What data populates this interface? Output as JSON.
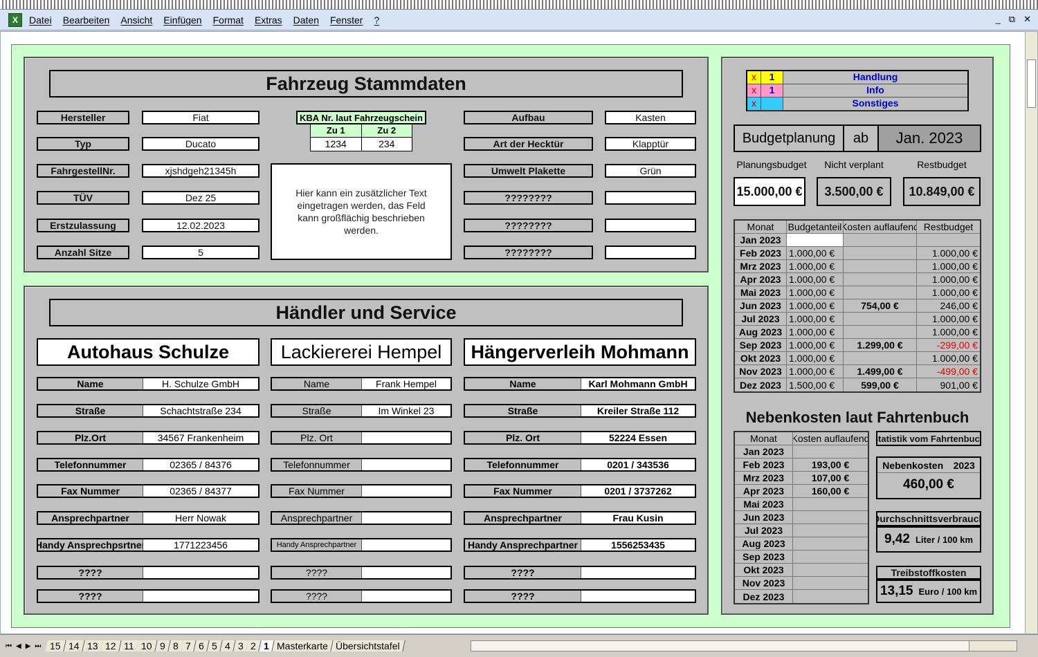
{
  "menu": [
    "Datei",
    "Bearbeiten",
    "Ansicht",
    "Einfügen",
    "Format",
    "Extras",
    "Daten",
    "Fenster",
    "?"
  ],
  "app_icon": "excel-icon",
  "window_controls": [
    "_",
    "⧉",
    "✕"
  ],
  "stammdaten": {
    "title": "Fahrzeug Stammdaten",
    "left": [
      {
        "label": "Hersteller",
        "value": "Fiat"
      },
      {
        "label": "Typ",
        "value": "Ducato"
      },
      {
        "label": "FahrgestellNr.",
        "value": "xjshdgeh21345h"
      },
      {
        "label": "TÜV",
        "value": "Dez 25"
      },
      {
        "label": "Erstzulassung",
        "value": "12.02.2023"
      },
      {
        "label": "Anzahl Sitze",
        "value": "5"
      }
    ],
    "kba": {
      "title": "KBA Nr. laut Fahrzeugschein",
      "h1": "Zu 1",
      "h2": "Zu 2",
      "v1": "1234",
      "v2": "234"
    },
    "note": "Hier kann ein zusätzlicher Text eingetragen werden, das Feld kann großflächig beschrieben werden.",
    "right": [
      {
        "label": "Aufbau",
        "value": "Kasten"
      },
      {
        "label": "Art der Hecktür",
        "value": "Klapptür"
      },
      {
        "label": "Umwelt Plakette",
        "value": "Grün"
      },
      {
        "label": "????????",
        "value": ""
      },
      {
        "label": "????????",
        "value": ""
      },
      {
        "label": "????????",
        "value": ""
      }
    ]
  },
  "haendler": {
    "title": "Händler und Service",
    "dealers": [
      {
        "name": "Autohaus Schulze",
        "bold": true,
        "rows": [
          {
            "label": "Name",
            "value": "H. Schulze GmbH"
          },
          {
            "label": "Straße",
            "value": "Schachtstraße 234"
          },
          {
            "label": "Plz.Ort",
            "value": "34567 Frankenheim"
          },
          {
            "label": "Telefonnummer",
            "value": "02365 / 84376"
          },
          {
            "label": "Fax Nummer",
            "value": "02365 / 84377"
          },
          {
            "label": "Ansprechpartner",
            "value": "Herr Nowak"
          },
          {
            "label": "Handy Ansprechpsrtner",
            "value": "1771223456"
          },
          {
            "label": "????",
            "value": ""
          },
          {
            "label": "????",
            "value": ""
          }
        ]
      },
      {
        "name": "Lackiererei Hempel",
        "bold": false,
        "rows": [
          {
            "label": "Name",
            "value": "Frank Hempel"
          },
          {
            "label": "Straße",
            "value": "Im Winkel 23"
          },
          {
            "label": "Plz. Ort",
            "value": ""
          },
          {
            "label": "Telefonnummer",
            "value": ""
          },
          {
            "label": "Fax Nummer",
            "value": ""
          },
          {
            "label": "Ansprechpartner",
            "value": ""
          },
          {
            "label": "Handy Ansprechpartner",
            "value": ""
          },
          {
            "label": "????",
            "value": ""
          },
          {
            "label": "????",
            "value": ""
          }
        ]
      },
      {
        "name": "Hängerverleih Mohmann",
        "bold": true,
        "rows": [
          {
            "label": "Name",
            "value": "Karl Mohmann GmbH"
          },
          {
            "label": "Straße",
            "value": "Kreiler Straße 112"
          },
          {
            "label": "Plz. Ort",
            "value": "52224 Essen"
          },
          {
            "label": "Telefonnummer",
            "value": "0201 / 343536"
          },
          {
            "label": "Fax Nummer",
            "value": "0201 / 3737262"
          },
          {
            "label": "Ansprechpartner",
            "value": "Frau Kusin"
          },
          {
            "label": "Handy Ansprechpartner",
            "value": "1556253435"
          },
          {
            "label": "????",
            "value": ""
          },
          {
            "label": "????",
            "value": ""
          }
        ]
      }
    ]
  },
  "legend": [
    {
      "x": "x",
      "n": "1",
      "label": "Handlung",
      "color": "#ffff00"
    },
    {
      "x": "x",
      "n": "1",
      "label": "Info",
      "color": "#ff99cc"
    },
    {
      "x": "x",
      "n": "",
      "label": "Sonstiges",
      "color": "#33ccff"
    }
  ],
  "budget": {
    "title": "Budgetplanung",
    "ab": "ab",
    "start": "Jan. 2023",
    "plan_label": "Planungsbudget",
    "plan_value": "15.000,00 €",
    "free_label": "Nicht verplant",
    "free_value": "3.500,00 €",
    "rest_label": "Restbudget",
    "rest_value": "10.849,00 €",
    "headers": [
      "Monat",
      "Budgetanteil",
      "Kosten auflaufend",
      "Restbudget"
    ],
    "rows": [
      [
        "Jan 2023",
        "",
        "",
        ""
      ],
      [
        "Feb 2023",
        "1.000,00 €",
        "",
        "1.000,00 €"
      ],
      [
        "Mrz 2023",
        "1.000,00 €",
        "",
        "1.000,00 €"
      ],
      [
        "Apr 2023",
        "1.000,00 €",
        "",
        "1.000,00 €"
      ],
      [
        "Mai 2023",
        "1.000,00 €",
        "",
        "1.000,00 €"
      ],
      [
        "Jun 2023",
        "1.000,00 €",
        "754,00 €",
        "246,00 €"
      ],
      [
        "Jul 2023",
        "1.000,00 €",
        "",
        "1.000,00 €"
      ],
      [
        "Aug 2023",
        "1.000,00 €",
        "",
        "1.000,00 €"
      ],
      [
        "Sep 2023",
        "1.000,00 €",
        "1.299,00 €",
        "-299,00 €"
      ],
      [
        "Okt 2023",
        "1.000,00 €",
        "",
        "1.000,00 €"
      ],
      [
        "Nov 2023",
        "1.000,00 €",
        "1.499,00 €",
        "-499,00 €"
      ],
      [
        "Dez 2023",
        "1.500,00 €",
        "599,00 €",
        "901,00 €"
      ]
    ]
  },
  "nebenkosten": {
    "title": "Nebenkosten laut Fahrtenbuch",
    "headers": [
      "Monat",
      "Kosten auflaufend"
    ],
    "rows": [
      [
        "Jan 2023",
        ""
      ],
      [
        "Feb 2023",
        "193,00 €"
      ],
      [
        "Mrz 2023",
        "107,00 €"
      ],
      [
        "Apr 2023",
        "160,00 €"
      ],
      [
        "Mai 2023",
        ""
      ],
      [
        "Jun 2023",
        ""
      ],
      [
        "Jul 2023",
        ""
      ],
      [
        "Aug 2023",
        ""
      ],
      [
        "Sep 2023",
        ""
      ],
      [
        "Okt 2023",
        ""
      ],
      [
        "Nov 2023",
        ""
      ],
      [
        "Dez 2023",
        ""
      ]
    ],
    "stat_title": "Statistik vom Fahrtenbuch",
    "nk_label": "Nebenkosten",
    "nk_year": "2023",
    "nk_value": "460,00 €",
    "avg_label": "Durchschnittsverbrauch",
    "avg_value": "9,42",
    "avg_unit": "Liter / 100 km",
    "fuel_label": "Treibstoffkosten",
    "fuel_value": "13,15",
    "fuel_unit": "Euro / 100 km"
  },
  "sheet_tabs": [
    "15",
    "14",
    "13",
    "12",
    "11",
    "10",
    "9",
    "8",
    "7",
    "6",
    "5",
    "4",
    "3",
    "2",
    "1",
    "Masterkarte",
    "Übersichtstafel"
  ],
  "active_tab": "1",
  "tab_nav": [
    "⏮",
    "◀",
    "▶",
    "⏭"
  ]
}
